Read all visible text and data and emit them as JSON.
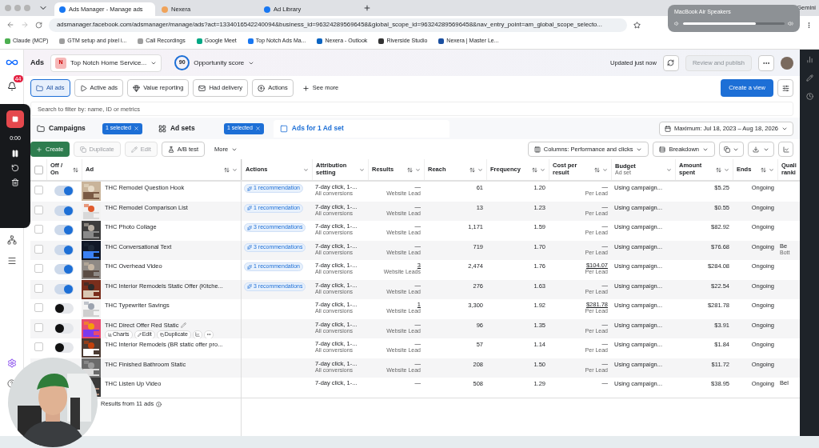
{
  "browser": {
    "tabs": [
      {
        "title": "Ads Manager - Manage ads",
        "selected": true
      },
      {
        "title": "Nexera",
        "selected": false
      },
      {
        "title": "Ad Library",
        "selected": false
      }
    ],
    "url": "adsmanager.facebook.com/adsmanager/manage/ads?act=1334016542240094&business_id=963242895696458&global_scope_id=963242895696458&nav_entry_point=am_global_scope_selecto...",
    "profile": "Gemini",
    "bookmarks": [
      "Claude (MCP)",
      "GTM setup and pixel i...",
      "Call Recordings",
      "Google Meet",
      "Top Notch Ads Ma...",
      "Nexera - Outlook",
      "Riverside Studio",
      "Nexera | Master Le..."
    ]
  },
  "audio_popup": {
    "title": "MacBook Air Speakers",
    "level": 0.72
  },
  "recorder": {
    "time": "0:00"
  },
  "sidebar": {
    "notifications": "44"
  },
  "header": {
    "title": "Ads",
    "account_initial": "N",
    "account": "Top Notch Home Service...",
    "score": "90",
    "score_label": "Opportunity score",
    "updated": "Updated just now",
    "publish": {
      "label": "Review and publish",
      "disabled": true
    }
  },
  "views": [
    {
      "label": "All ads",
      "kind": "folder",
      "selected": true
    },
    {
      "label": "Active ads",
      "kind": "play",
      "selected": false
    },
    {
      "label": "Value reporting",
      "kind": "value",
      "selected": false
    },
    {
      "label": "Had delivery",
      "kind": "delivery",
      "selected": false
    },
    {
      "label": "Actions",
      "kind": "actions",
      "selected": false
    }
  ],
  "see_more": "See more",
  "create_view": "Create a view",
  "search": {
    "placeholder": "Search to filter by: name, ID or metrics"
  },
  "levels": [
    {
      "label": "Campaigns",
      "badge": "1 selected",
      "kind": "campaign",
      "selected": false
    },
    {
      "label": "Ad sets",
      "badge": "1 selected",
      "kind": "adset",
      "selected": false
    },
    {
      "label": "Ads for 1 Ad set",
      "kind": "ad",
      "selected": true
    }
  ],
  "date_range": "Maximum: Jul 18, 2023 – Aug 18, 2026",
  "toolbar": {
    "left": [
      {
        "label": "Create",
        "kind": "create",
        "disabled": false
      },
      {
        "label": "Duplicate",
        "kind": "duplicate",
        "disabled": true
      },
      {
        "label": "Edit",
        "kind": "edit",
        "disabled": true
      },
      {
        "label": "A/B test",
        "kind": "test",
        "disabled": false
      },
      {
        "label": "More",
        "kind": "more",
        "disabled": false
      }
    ],
    "right": [
      {
        "label": "Columns: Performance and clicks",
        "kind": "columns"
      },
      {
        "label": "Breakdown",
        "kind": "breakdown"
      }
    ]
  },
  "table": {
    "all_selected": false,
    "columns": [
      {
        "label": "Off / On",
        "sortable": true,
        "menu": false
      },
      {
        "label": "Ad",
        "sortable": true,
        "menu": true
      },
      {
        "label": "Actions",
        "sortable": false,
        "menu": true
      },
      {
        "label": "Attribution setting",
        "sortable": false,
        "menu": true
      },
      {
        "label": "Results",
        "sortable": true,
        "menu": true
      },
      {
        "label": "Reach",
        "sortable": true,
        "menu": true
      },
      {
        "label": "Frequency",
        "sortable": true,
        "menu": true
      },
      {
        "label": "Cost per result",
        "sortable": true,
        "menu": true
      },
      {
        "label": "Budget",
        "sublabel": "Ad set",
        "sortable": false,
        "menu": true
      },
      {
        "label": "Amount spent",
        "sortable": true,
        "menu": true
      },
      {
        "label": "Ends",
        "sortable": true,
        "menu": true
      },
      {
        "label": "Quali ranki"
      }
    ],
    "rows": [
      {
        "selected": false,
        "on": true,
        "name": "THC Remodel Question Hook",
        "recommendation": "1 recommendation",
        "attribution": "7-day click, 1-...",
        "attribution_sub": "All conversions",
        "results": "—",
        "results_label": "Website Lead",
        "linked": false,
        "reach": "61",
        "frequency": "1.20",
        "cost": "—",
        "cost_label": "Per Lead",
        "budget": "Using campaign...",
        "spent": "$5.25",
        "ends": "Ongoing"
      },
      {
        "selected": false,
        "on": true,
        "name": "THC Remodel Comparison List",
        "recommendation": "1 recommendation",
        "attribution": "7-day click, 1-...",
        "attribution_sub": "All conversions",
        "results": "—",
        "results_label": "Website Lead",
        "linked": false,
        "reach": "13",
        "frequency": "1.23",
        "cost": "—",
        "cost_label": "Per Lead",
        "budget": "Using campaign...",
        "spent": "$0.55",
        "ends": "Ongoing"
      },
      {
        "selected": false,
        "on": true,
        "name": "THC Photo Collage",
        "recommendation": "3 recommendations",
        "attribution": "7-day click, 1-...",
        "attribution_sub": "All conversions",
        "results": "—",
        "results_label": "Website Lead",
        "linked": false,
        "reach": "1,171",
        "frequency": "1.59",
        "cost": "—",
        "cost_label": "Per Lead",
        "budget": "Using campaign...",
        "spent": "$82.92",
        "ends": "Ongoing"
      },
      {
        "selected": false,
        "on": true,
        "name": "THC Conversational Text",
        "recommendation": "3 recommendations",
        "attribution": "7-day click, 1-...",
        "attribution_sub": "All conversions",
        "results": "—",
        "results_label": "Website Lead",
        "linked": false,
        "reach": "719",
        "frequency": "1.70",
        "cost": "—",
        "cost_label": "Per Lead",
        "budget": "Using campaign...",
        "spent": "$76.68",
        "ends": "Ongoing",
        "quality": "Be",
        "quality_sub": "Bott"
      },
      {
        "selected": false,
        "on": true,
        "name": "THC Overhead Video",
        "recommendation": "1 recommendation",
        "attribution": "7-day click, 1-...",
        "attribution_sub": "All conversions",
        "results": "3",
        "results_label": "Website Leads",
        "linked": true,
        "reach": "2,474",
        "frequency": "1.76",
        "cost": "$104.07",
        "cost_label": "Per Lead",
        "budget": "Using campaign...",
        "spent": "$284.08",
        "ends": "Ongoing"
      },
      {
        "selected": false,
        "on": true,
        "name": "THC Interior Remodels Static Offer (Kitche...",
        "recommendation": "3 recommendations",
        "attribution": "7-day click, 1-...",
        "attribution_sub": "All conversions",
        "results": "—",
        "results_label": "Website Lead",
        "linked": false,
        "reach": "276",
        "frequency": "1.63",
        "cost": "—",
        "cost_label": "Per Lead",
        "budget": "Using campaign...",
        "spent": "$22.54",
        "ends": "Ongoing"
      },
      {
        "selected": false,
        "on": false,
        "name": "THC Typewriter Savings",
        "attribution": "7-day click, 1-...",
        "attribution_sub": "All conversions",
        "results": "1",
        "results_label": "Website Lead",
        "linked": true,
        "reach": "3,300",
        "frequency": "1.92",
        "cost": "$281.78",
        "cost_label": "Per Lead",
        "budget": "Using campaign...",
        "spent": "$281.78",
        "ends": "Ongoing"
      },
      {
        "selected": false,
        "on": false,
        "name": "THC Direct Offer Red Static",
        "hover_actions": [
          "Charts",
          "Edit",
          "Duplicate"
        ],
        "attribution": "7-day click, 1-...",
        "attribution_sub": "All conversions",
        "results": "—",
        "results_label": "Website Lead",
        "linked": false,
        "reach": "96",
        "frequency": "1.35",
        "cost": "—",
        "cost_label": "Per Lead",
        "budget": "Using campaign...",
        "spent": "$3.91",
        "ends": "Ongoing"
      },
      {
        "selected": false,
        "on": false,
        "name": "THC Interior Remodels (BR static offer pro...",
        "attribution": "7-day click, 1-...",
        "attribution_sub": "All conversions",
        "results": "—",
        "results_label": "Website Lead",
        "linked": false,
        "reach": "57",
        "frequency": "1.14",
        "cost": "—",
        "cost_label": "Per Lead",
        "budget": "Using campaign...",
        "spent": "$1.84",
        "ends": "Ongoing"
      },
      {
        "name": "THC Finished Bathroom Static",
        "attribution": "7-day click, 1-...",
        "attribution_sub": "All conversions",
        "results": "—",
        "results_label": "Website Lead",
        "linked": false,
        "reach": "208",
        "frequency": "1.50",
        "cost": "—",
        "cost_label": "Per Lead",
        "budget": "Using campaign...",
        "spent": "$11.72",
        "ends": "Ongoing"
      },
      {
        "name": "THC Listen Up Video",
        "attribution": "7-day click, 1-...",
        "results": "—",
        "linked": false,
        "reach": "508",
        "frequency": "1.29",
        "cost": "—",
        "budget": "Using campaign...",
        "spent": "$38.95",
        "ends": "Ongoing",
        "quality": "Bel"
      }
    ],
    "footer": "Results from 11 ads"
  }
}
